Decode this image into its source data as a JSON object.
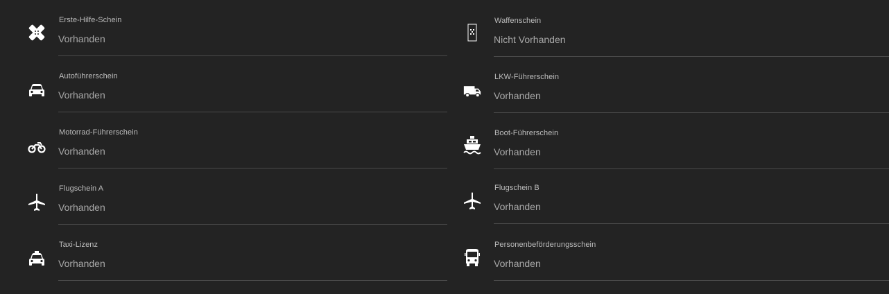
{
  "licenses_left": [
    {
      "label": "Erste-Hilfe-Schein",
      "value": "Vorhanden",
      "icon": "first-aid-bandage-icon"
    },
    {
      "label": "Autoführerschein",
      "value": "Vorhanden",
      "icon": "car-icon"
    },
    {
      "label": "Motorrad-Führerschein",
      "value": "Vorhanden",
      "icon": "motorcycle-icon"
    },
    {
      "label": "Flugschein A",
      "value": "Vorhanden",
      "icon": "airplane-icon"
    },
    {
      "label": "Taxi-Lizenz",
      "value": "Vorhanden",
      "icon": "taxi-icon"
    }
  ],
  "licenses_right": [
    {
      "label": "Waffenschein",
      "value": "Nicht Vorhanden",
      "icon": "weapon-license-icon"
    },
    {
      "label": "LKW-Führerschein",
      "value": "Vorhanden",
      "icon": "truck-icon"
    },
    {
      "label": "Boot-Führerschein",
      "value": "Vorhanden",
      "icon": "boat-icon"
    },
    {
      "label": "Flugschein B",
      "value": "Vorhanden",
      "icon": "airplane-icon"
    },
    {
      "label": "Personenbeförderungsschein",
      "value": "Vorhanden",
      "icon": "bus-icon"
    }
  ],
  "colors": {
    "background": "#232323",
    "label": "#bdbdbd",
    "value": "#a9a9a9",
    "divider": "#4a4a4a",
    "icon": "#ffffff"
  }
}
